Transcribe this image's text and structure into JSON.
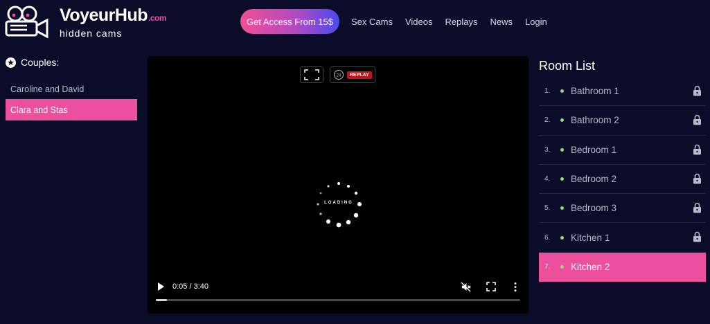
{
  "brand": {
    "name": "VoyeurHub",
    "tld": ".com",
    "tagline": "hidden cams"
  },
  "header": {
    "cta_label": "Get Access From 15$",
    "nav": [
      "Sex Cams",
      "Videos",
      "Replays",
      "News",
      "Login"
    ]
  },
  "sidebar": {
    "title": "Couples:",
    "items": [
      {
        "label": "Caroline and David",
        "active": false
      },
      {
        "label": "Clara and Stas",
        "active": true
      }
    ]
  },
  "player": {
    "replay_badge": "REPLAY",
    "replay_hours": "24",
    "loading_text": "LOADING",
    "time": "0:05 / 3:40",
    "progress": 0.03
  },
  "rooms": {
    "title": "Room List",
    "items": [
      {
        "num": "1.",
        "name": "Bathroom 1",
        "locked": true
      },
      {
        "num": "2.",
        "name": "Bathroom 2",
        "locked": true
      },
      {
        "num": "3.",
        "name": "Bedroom 1",
        "locked": true
      },
      {
        "num": "4.",
        "name": "Bedroom 2",
        "locked": true
      },
      {
        "num": "5.",
        "name": "Bedroom 3",
        "locked": true
      },
      {
        "num": "6.",
        "name": "Kitchen 1",
        "locked": true
      },
      {
        "num": "7.",
        "name": "Kitchen 2",
        "locked": false,
        "active": true
      }
    ]
  },
  "colors": {
    "accent": "#ec4f9b",
    "background": "#0b0b2a",
    "online": "#8ee078"
  }
}
